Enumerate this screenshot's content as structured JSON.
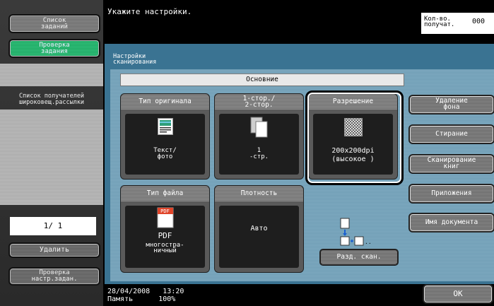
{
  "sidebar": {
    "job_list": "Список заданий",
    "check_job": "Проверка задания",
    "recipient_list": "Список получателей широковещ.рассылки",
    "page_counter": "1/ 1",
    "delete": "Удалить",
    "check_settings": "Проверка настр.задан."
  },
  "header": {
    "message": "Укажите настройки.",
    "recipients_label_1": "Кол-во.",
    "recipients_label_2": "получат.",
    "recipients_value": "000"
  },
  "panel": {
    "title_1": "Настройки",
    "title_2": "сканирования",
    "tab": "Основние"
  },
  "cards": {
    "original_type": {
      "title": "Тип оригинала",
      "line1": "Текст/",
      "line2": "фото"
    },
    "sides": {
      "title1": "1-стор./",
      "title2": "2-стор.",
      "line1": "1",
      "line2": "-стр."
    },
    "resolution": {
      "title": "Разрешение",
      "line1": "200x200dpi",
      "line2": "(высокое )"
    },
    "file_type": {
      "title": "Тип файла",
      "line1": "PDF",
      "line2": "многостра-",
      "line3": "ничный",
      "icon_text": "PDF"
    },
    "density": {
      "title": "Плотность",
      "value": "Авто"
    }
  },
  "right_buttons": {
    "bg_removal_1": "Удаление",
    "bg_removal_2": "фона",
    "erase": "Стирание",
    "book_scan_1": "Сканирование",
    "book_scan_2": "книг",
    "applications": "Приложения",
    "doc_name": "Имя документа"
  },
  "separate_scan": "Разд. скан.",
  "footer": {
    "date": "28/04/2008",
    "time": "13:20",
    "memory_label": "Память",
    "memory_value": "100%",
    "ok": "OK"
  },
  "colors": {
    "panel_blue": "#3a7392",
    "inner_blue": "#7faac0",
    "accent_green": "#1ea563"
  }
}
